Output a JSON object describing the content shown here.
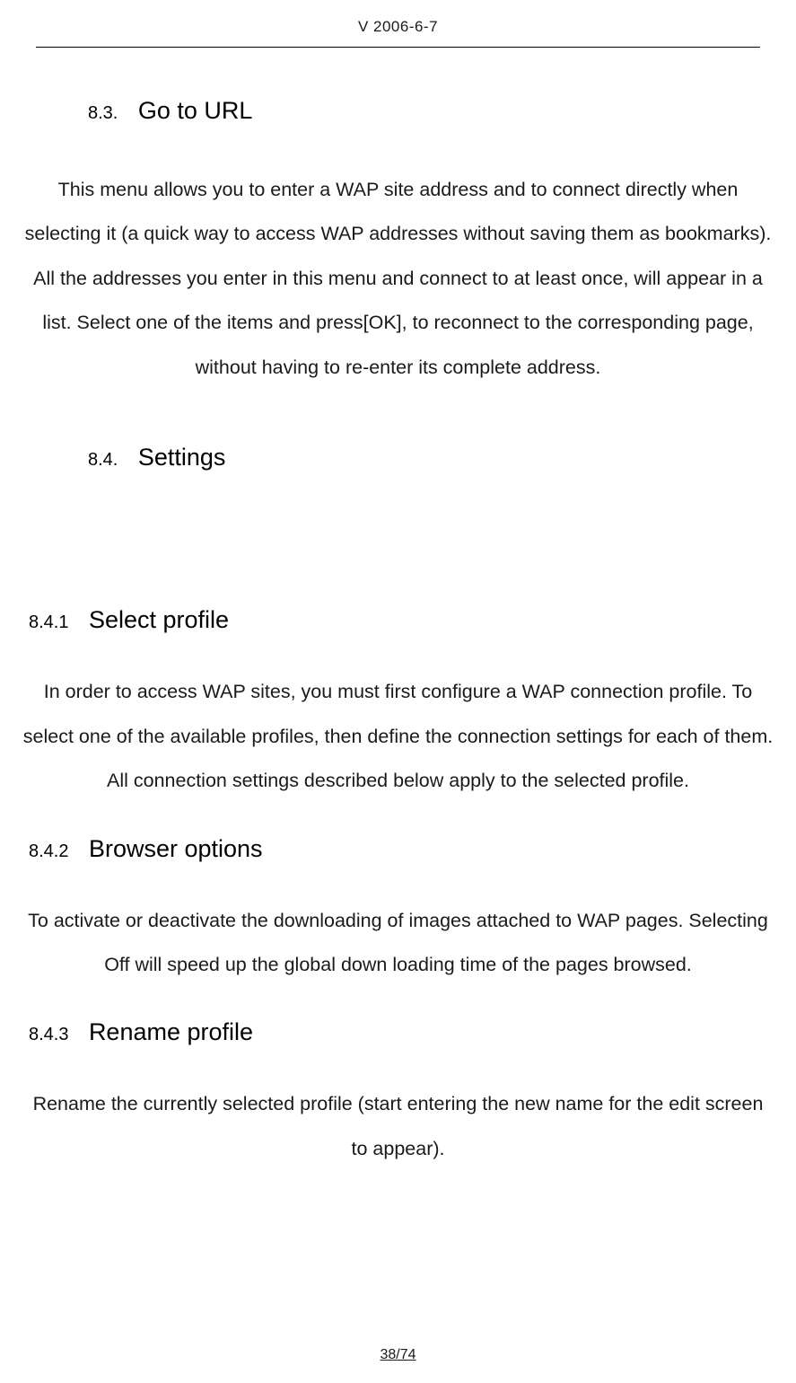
{
  "header": {
    "version": "V 2006-6-7"
  },
  "sections": {
    "s83": {
      "number": "8.3.",
      "title": "Go to URL",
      "body": "This menu allows you to enter a WAP site address and to connect directly when selecting it (a quick way to access WAP addresses without saving them as bookmarks). All the addresses you enter in this menu and connect to at least once, will appear in a list. Select one of the items and press[OK], to reconnect to the corresponding page, without having to re-enter its complete address."
    },
    "s84": {
      "number": "8.4.",
      "title": "Settings"
    },
    "s841": {
      "number": "8.4.1",
      "title": "Select profile",
      "body": "In order to access WAP sites, you must first configure a WAP connection profile. To select one of the available profiles, then define the connection settings for each of them. All connection settings described below apply to the selected profile."
    },
    "s842": {
      "number": "8.4.2",
      "title": "Browser options",
      "body": "To activate or deactivate the downloading of images attached to WAP pages. Selecting Off will speed up the global down loading time of the pages browsed."
    },
    "s843": {
      "number": "8.4.3",
      "title": "Rename profile",
      "body": "Rename the currently selected profile (start entering the new name for the edit screen to appear)."
    }
  },
  "footer": {
    "pageNumber": "38/74"
  }
}
